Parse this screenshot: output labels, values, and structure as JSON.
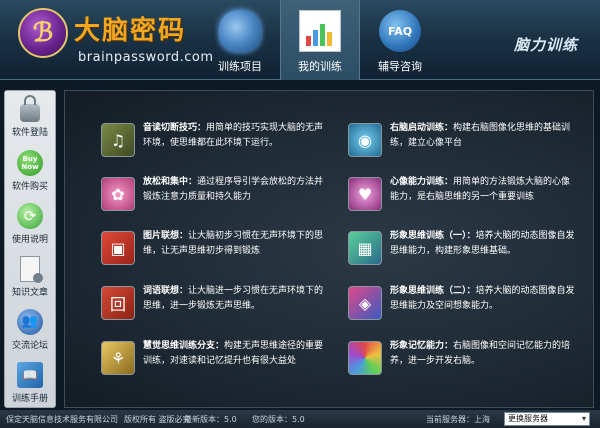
{
  "app": {
    "brand_name": "大脑密码",
    "brand_url": "brainpassword.com",
    "logo_glyph": "ℬ",
    "slogan": "脑力训练"
  },
  "nav": [
    {
      "label": "训练项目",
      "icon": "brain-icon",
      "active": false
    },
    {
      "label": "我的训练",
      "icon": "chart-icon",
      "active": true
    },
    {
      "label": "辅导咨询",
      "icon": "faq-icon",
      "icon_text": "FAQ",
      "active": false
    }
  ],
  "sidebar": [
    {
      "label": "软件登陆",
      "icon": "lock-icon"
    },
    {
      "label": "软件购买",
      "icon": "buy-now-icon",
      "icon_text": "Buy Now"
    },
    {
      "label": "使用说明",
      "icon": "help-icon"
    },
    {
      "label": "知识文章",
      "icon": "document-icon"
    },
    {
      "label": "交流论坛",
      "icon": "forum-icon"
    },
    {
      "label": "训练手册",
      "icon": "manual-icon"
    }
  ],
  "cards": [
    {
      "title": "音读切断技巧：",
      "desc": "用简单的技巧实现大脑的无声环境，使思维都在此环境下运行。",
      "icon": "music-note-icon",
      "color": "#5e6b3a"
    },
    {
      "title": "右脑启动训练：",
      "desc": "构建右脑图像化思维的基础训练，建立心像平台",
      "icon": "camera-icon",
      "color": "#2f7a9c"
    },
    {
      "title": "放松和集中：",
      "desc": "通过程序导引学会放松的方法并锻炼注意力质量和持久能力",
      "icon": "flower-icon",
      "color": "#c44f86"
    },
    {
      "title": "心像能力训练：",
      "desc": "用简单的方法锻炼大脑的心像能力，是右脑思维的另一个重要训练",
      "icon": "heart-icon",
      "color": "#a3438e"
    },
    {
      "title": "图片联想：",
      "desc": "让大脑初步习惯在无声环境下的思维，让无声思维初步得到锻炼",
      "icon": "image-icon",
      "color": "#c63a2e"
    },
    {
      "title": "形象思维训练（一）：",
      "desc": "培养大脑的动态图像自发思维能力，构建形象思维基础。",
      "icon": "grid-icon",
      "color": "#3d8a6a"
    },
    {
      "title": "词语联想：",
      "desc": "让大脑进一步习惯在无声环境下的思维，进一步锻炼无声思维。",
      "icon": "word-icon",
      "color": "#b83a2a"
    },
    {
      "title": "形象思维训练（二）：",
      "desc": "培养大脑的动态图像自发思维能力及空间想象能力。",
      "icon": "cube-icon",
      "color": "#6a4a9c"
    },
    {
      "title": "慧觉思维训练分支：",
      "desc": "构建无声思维途径的重要训练，对速读和记忆提升也有很大益处",
      "icon": "branch-icon",
      "color": "#b89a3a"
    },
    {
      "title": "形象记忆能力：",
      "desc": "右脑图像和空间记忆能力的培养，进一步开发右脑。",
      "icon": "color-wheel-icon",
      "color": "#8a5aa6"
    }
  ],
  "status": {
    "company": "保定天脑信息技术服务有限公司",
    "copyright": "版权所有 盗版必究",
    "latest_version": "最新版本：5.0",
    "your_version": "您的版本：5.0",
    "server_label": "当前服务器：上海",
    "server_select": "更换服务器"
  }
}
